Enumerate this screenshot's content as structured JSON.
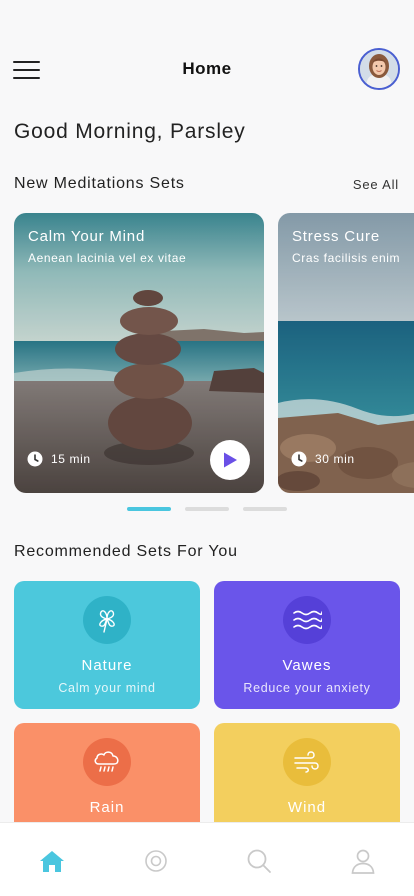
{
  "header": {
    "title": "Home",
    "menu_icon": "hamburger-menu-icon",
    "avatar_icon": "user-avatar"
  },
  "greeting": "Good Morning, Parsley",
  "new_sets": {
    "title": "New Meditations Sets",
    "see_all": "See All",
    "cards": [
      {
        "title": "Calm Your Mind",
        "subtitle": "Aenean lacinia vel ex vitae",
        "duration": "15 min",
        "has_play": true
      },
      {
        "title": "Stress Cure",
        "subtitle": "Cras facilisis enim",
        "duration": "30 min",
        "has_play": false
      }
    ],
    "pager": {
      "count": 3,
      "active": 0
    }
  },
  "recommended": {
    "title": "Recommended Sets For You",
    "tiles": [
      {
        "name": "Nature",
        "subtitle": "Calm your mind",
        "icon": "clover-icon",
        "color": "#4cc8dc",
        "icon_bg": "#2fb2c7"
      },
      {
        "name": "Vawes",
        "subtitle": "Reduce your anxiety",
        "icon": "waves-icon",
        "color": "#6a55ea",
        "icon_bg": "#5540d8"
      },
      {
        "name": "Rain",
        "subtitle": "",
        "icon": "rain-cloud-icon",
        "color": "#fa9068",
        "icon_bg": "#ec6e48"
      },
      {
        "name": "Wind",
        "subtitle": "",
        "icon": "wind-icon",
        "color": "#f3cf5e",
        "icon_bg": "#e9bd3b"
      }
    ]
  },
  "tabbar": {
    "items": [
      {
        "icon": "home-icon",
        "active": true
      },
      {
        "icon": "meditate-icon",
        "active": false
      },
      {
        "icon": "search-icon",
        "active": false
      },
      {
        "icon": "profile-icon",
        "active": false
      }
    ],
    "active_color": "#4ac6df",
    "inactive_color": "#c9c9c9"
  }
}
